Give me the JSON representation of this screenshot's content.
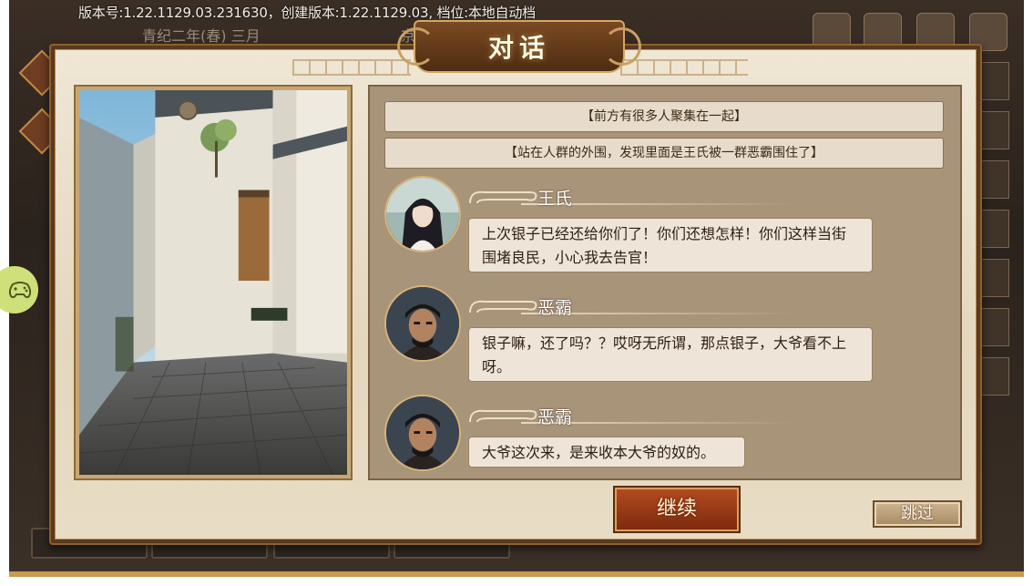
{
  "status_bar": {
    "version_text": "版本号:1.22.1129.03.231630，创建版本:1.22.1129.03, 档位:本地自动档"
  },
  "background": {
    "date": "青纪二年(春) 三月",
    "city": "京"
  },
  "dialog": {
    "title": "对话",
    "narrations": [
      "【前方有很多人聚集在一起】",
      "【站在人群的外围，发现里面是王氏被一群恶霸围住了】"
    ],
    "speeches": [
      {
        "speaker": "王氏",
        "text": "上次银子已经还给你们了！你们还想怎样！你们这样当街围堵良民，小心我去告官！",
        "avatar": "female-portrait"
      },
      {
        "speaker": "恶霸",
        "text": "银子嘛，还了吗？？哎呀无所谓，那点银子，大爷看不上呀。",
        "avatar": "male-portrait"
      },
      {
        "speaker": "恶霸",
        "text": "大爷这次来，是来收本大爷的奴的。",
        "avatar": "male-portrait"
      }
    ],
    "continue_label": "继续",
    "skip_label": "跳过"
  },
  "colors": {
    "frame_brown": "#5a3a1e",
    "parchment": "#e4d7be",
    "continue_red": "#b24a1f",
    "accent_gold": "#d8a05a"
  }
}
